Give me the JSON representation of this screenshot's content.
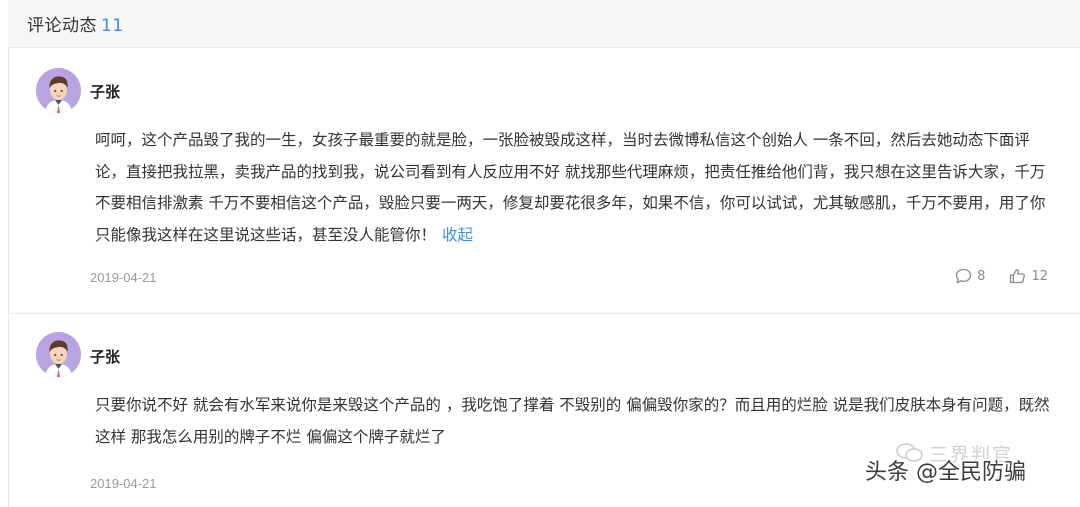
{
  "header": {
    "title": "评论动态",
    "count": "11"
  },
  "comments": [
    {
      "author": "子张",
      "text": "呵呵，这个产品毁了我的一生，女孩子最重要的就是脸，一张脸被毁成这样，当时去微博私信这个创始人 一条不回，然后去她动态下面评论，直接把我拉黑，卖我产品的找到我，说公司看到有人反应用不好 就找那些代理麻烦，把责任推给他们背，我只想在这里告诉大家，千万不要相信排激素 千万不要相信这个产品，毁脸只要一两天，修复却要花很多年，如果不信，你可以试试，尤其敏感肌，千万不要用，用了你只能像我这样在这里说这些话，甚至没人能管你！",
      "collapse_label": "收起",
      "date": "2019-04-21",
      "replies": "8",
      "likes": "12"
    },
    {
      "author": "子张",
      "text": "只要你说不好 就会有水军来说你是来毁这个产品的 ，我吃饱了撑着 不毁别的 偏偏毁你家的？而且用的烂脸 说是我们皮肤本身有问题，既然这样 那我怎么用别的牌子不烂 偏偏这个牌子就烂了",
      "date": "2019-04-21"
    }
  ],
  "watermark": {
    "faint_text": "三界判官",
    "main_text": "头条 @全民防骗"
  },
  "colors": {
    "accent": "#3a8ee6",
    "avatar_bg": "#b9a3e0",
    "header_bg": "#f5f6f7"
  },
  "icons": {
    "reply": "comment-bubble-icon",
    "like": "thumbs-up-icon"
  }
}
